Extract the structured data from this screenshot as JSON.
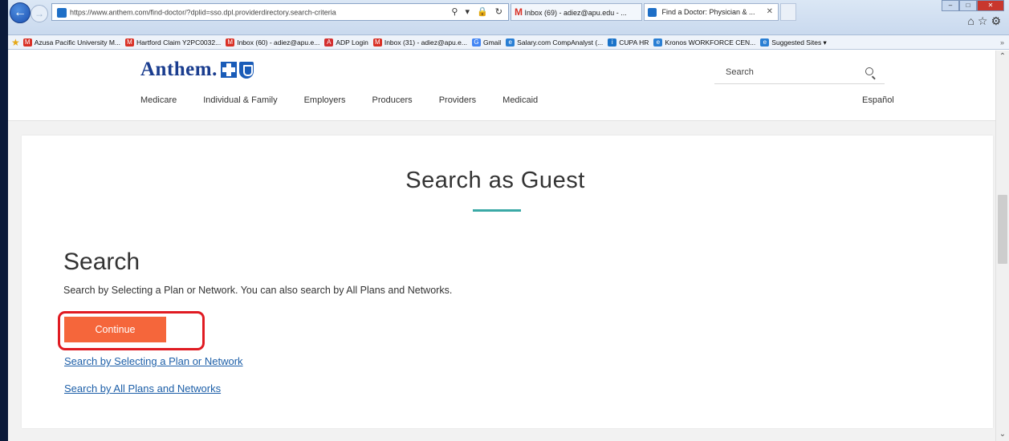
{
  "browser": {
    "url": "https://www.anthem.com/find-doctor/?dplid=sso.dpl.providerdirectory.search-criteria",
    "tabs": [
      {
        "label": "Inbox (69) - adiez@apu.edu - ...",
        "icon": "gmail-icon"
      },
      {
        "label": "Find a Doctor: Physician & ...",
        "icon": "anthem-site-icon"
      }
    ],
    "favorites": [
      {
        "label": "Azusa Pacific University M...",
        "icon": "gmail-icon",
        "color": "#d93025"
      },
      {
        "label": "Hartford Claim Y2PC0032...",
        "icon": "gmail-icon",
        "color": "#d93025"
      },
      {
        "label": "Inbox (60) - adiez@apu.e...",
        "icon": "gmail-icon",
        "color": "#d93025"
      },
      {
        "label": "ADP Login",
        "icon": "adp-icon",
        "color": "#d32f2f"
      },
      {
        "label": "Inbox (31) - adiez@apu.e...",
        "icon": "gmail-icon",
        "color": "#d93025"
      },
      {
        "label": "Gmail",
        "icon": "google-icon",
        "color": "#4285f4"
      },
      {
        "label": "Salary.com CompAnalyst (...",
        "icon": "ie-icon",
        "color": "#2a7fd4"
      },
      {
        "label": "CUPA HR",
        "icon": "cupa-icon",
        "color": "#1a73c9"
      },
      {
        "label": "Kronos WORKFORCE CEN...",
        "icon": "ie-icon",
        "color": "#2a7fd4"
      },
      {
        "label": "Suggested Sites ▾",
        "icon": "ie-icon",
        "color": "#2a7fd4"
      }
    ]
  },
  "header": {
    "logo_text": "Anthem.",
    "search_placeholder": "Search",
    "nav": [
      "Medicare",
      "Individual & Family",
      "Employers",
      "Producers",
      "Providers",
      "Medicaid"
    ],
    "language": "Español"
  },
  "main": {
    "guest_title": "Search as Guest",
    "section_title": "Search",
    "description": "Search by Selecting a Plan or Network. You can also search by All Plans and Networks.",
    "continue_label": "Continue",
    "links": [
      "Search by Selecting a Plan or Network",
      "Search by All Plans and Networks"
    ]
  },
  "colors": {
    "accent_orange": "#f5663b",
    "highlight_red": "#e01b22",
    "teal_rule": "#3aa9a6",
    "link_blue": "#1d5fa8",
    "brand_blue": "#1a3d8f"
  }
}
